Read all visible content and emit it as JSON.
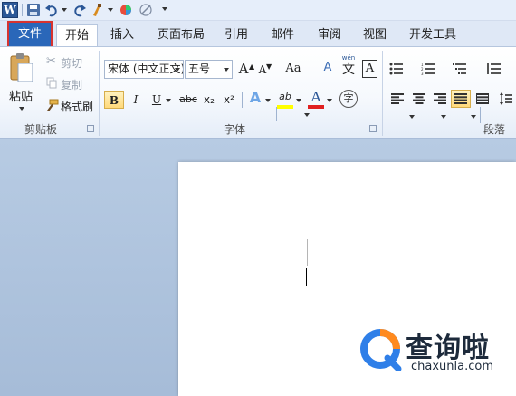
{
  "ribbon_tabs": {
    "file": "文件",
    "home": "开始",
    "others": [
      "插入",
      "页面布局",
      "引用",
      "邮件",
      "审阅",
      "视图",
      "开发工具"
    ]
  },
  "clipboard": {
    "paste": "粘贴",
    "cut": "剪切",
    "copy": "复制",
    "format_painter": "格式刷",
    "group_label": "剪贴板"
  },
  "font": {
    "name": "宋体 (中文正文)",
    "size": "五号",
    "group_label": "字体",
    "bold": "B",
    "italic": "I",
    "underline": "U",
    "strike": "abc",
    "subscript": "x₂",
    "superscript": "x²",
    "grow": "A",
    "shrink": "A",
    "change_case": "Aa",
    "clear_format": "A",
    "phonetic": "wén",
    "phonetic_char": "文",
    "border_char": "A",
    "text_effect": "A",
    "highlight": "ab",
    "font_color": "A",
    "enclose": "字"
  },
  "paragraph": {
    "group_label": "段落"
  },
  "colors": {
    "file_tab": "#2a67b9",
    "file_outline": "#d8332f",
    "highlight_yellow": "#ffff00",
    "font_red": "#e02020",
    "logo_blue": "#2f7fe8",
    "logo_orange": "#ff8a1f"
  },
  "watermark": {
    "text": "查询啦",
    "url": "chaxunla.com"
  }
}
